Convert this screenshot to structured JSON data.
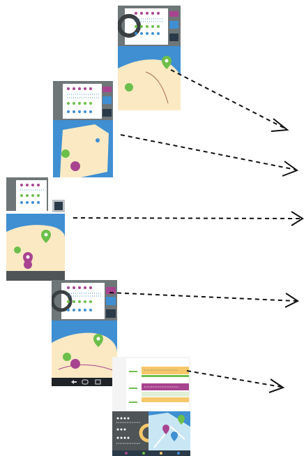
{
  "diagram": {
    "screens": [
      {
        "id": "screen-1",
        "device": "phone-portrait",
        "content": "dashboard-over-map"
      },
      {
        "id": "screen-2",
        "device": "phone-portrait",
        "content": "dashboard-over-map"
      },
      {
        "id": "screen-3",
        "device": "phone-landscape-cropped",
        "content": "dashboard-over-map"
      },
      {
        "id": "screen-4",
        "device": "phone-with-nav-bar",
        "content": "dashboard-over-map"
      },
      {
        "id": "screen-5",
        "device": "tablet-layout",
        "content": "list-and-map"
      }
    ],
    "arrow_style": "dashed-open-head",
    "colors": {
      "sea": "#3f8fd2",
      "land": "#fbe9c3",
      "panel": "#6f7678",
      "panel_dark": "#3a3f42",
      "purple": "#a8448f",
      "green": "#6cbf4a",
      "blue": "#3f8fd2",
      "navy": "#2b3a48",
      "orange": "#f6c76a",
      "route": "#a86a4e"
    },
    "icons": [
      "map-pin-icon",
      "back-icon",
      "home-icon",
      "recents-icon"
    ]
  }
}
